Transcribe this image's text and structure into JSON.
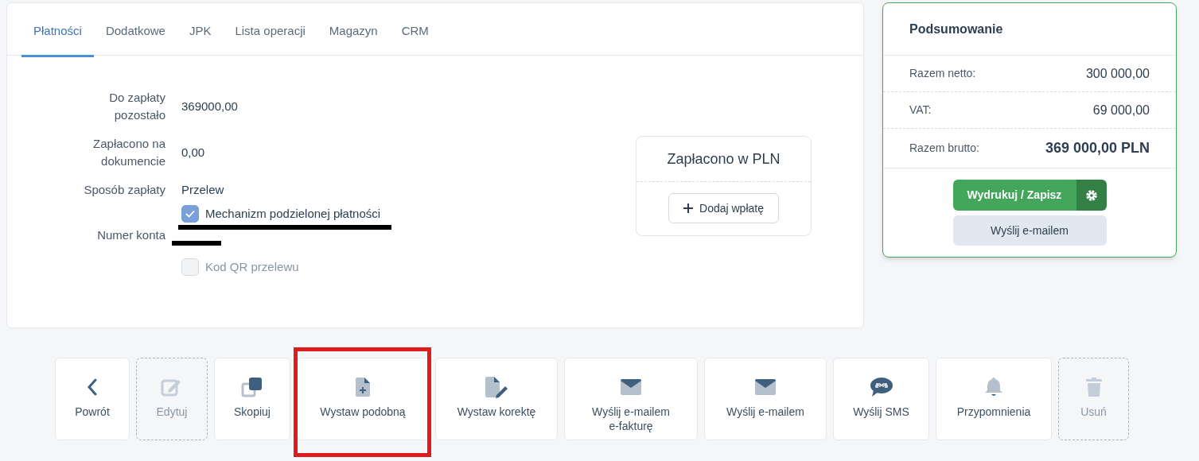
{
  "tabs": [
    {
      "label": "Płatności",
      "selected": true
    },
    {
      "label": "Dodatkowe",
      "selected": false
    },
    {
      "label": "JPK",
      "selected": false
    },
    {
      "label": "Lista operacji",
      "selected": false
    },
    {
      "label": "Magazyn",
      "selected": false
    },
    {
      "label": "CRM",
      "selected": false
    }
  ],
  "payment": {
    "remaining_label": "Do zapłaty pozostało",
    "remaining": "369000,00",
    "paid_label": "Zapłacono na dokumencie",
    "paid": "0,00",
    "method_label": "Sposób zapłaty",
    "method": "Przelew",
    "split_payment": {
      "label": "Mechanizm podzielonej płatności",
      "checked": true
    },
    "account_label": "Numer konta",
    "account_redacted": true,
    "qr_code": {
      "label": "Kod QR przelewu",
      "checked": false
    }
  },
  "paid_pln": {
    "title": "Zapłacono w PLN",
    "button": "Dodaj wpłatę"
  },
  "summary": {
    "title": "Podsumowanie",
    "rows": [
      {
        "label": "Razem netto:",
        "value": "300 000,00",
        "kind": "normal"
      },
      {
        "label": "VAT:",
        "value": "69 000,00",
        "kind": "normal"
      },
      {
        "label": "Razem brutto:",
        "value": "369 000,00 PLN",
        "kind": "total"
      }
    ],
    "print_button": "Wydrukuj / Zapisz",
    "email_button": "Wyślij e-mailem"
  },
  "actions": [
    {
      "label": "Powrót",
      "kind": "back",
      "disabled": false,
      "highlighted": false
    },
    {
      "label": "Edytuj",
      "kind": "edit",
      "disabled": true,
      "highlighted": false
    },
    {
      "label": "Skopiuj",
      "kind": "copy",
      "disabled": false,
      "highlighted": false
    },
    {
      "label": "Wystaw podobną",
      "kind": "new",
      "disabled": false,
      "highlighted": true
    },
    {
      "label": "Wystaw korektę",
      "kind": "correct",
      "disabled": false,
      "highlighted": false
    },
    {
      "label": "Wyślij e-mailem e-fakturę",
      "kind": "mail",
      "disabled": false,
      "highlighted": false
    },
    {
      "label": "Wyślij e-mailem",
      "kind": "mail",
      "disabled": false,
      "highlighted": false
    },
    {
      "label": "Wyślij SMS",
      "kind": "sms",
      "disabled": false,
      "highlighted": false
    },
    {
      "label": "Przypomnienia",
      "kind": "bell",
      "disabled": false,
      "highlighted": false
    },
    {
      "label": "Usuń",
      "kind": "trash",
      "disabled": true,
      "highlighted": false
    }
  ]
}
